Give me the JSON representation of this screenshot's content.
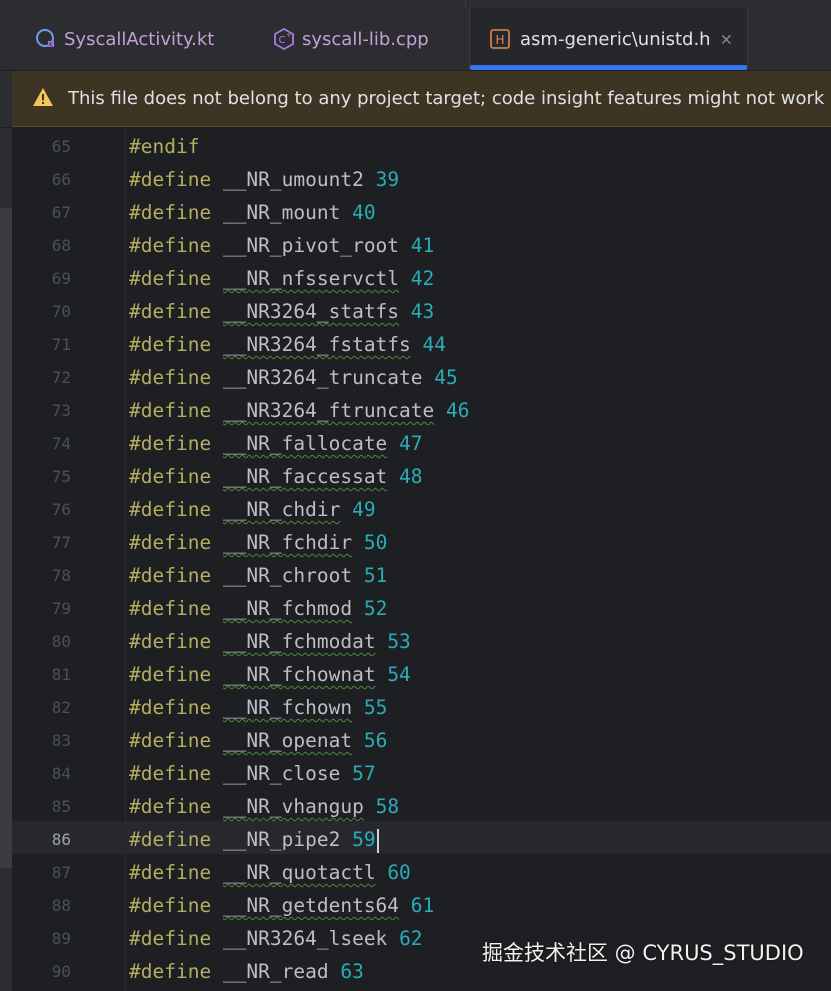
{
  "tabs": [
    {
      "label": "SyscallActivity.kt",
      "icon": "kotlin-class-icon",
      "active": false
    },
    {
      "label": "syscall-lib.cpp",
      "icon": "cpp-file-icon",
      "active": false
    },
    {
      "label": "asm-generic\\unistd.h",
      "icon": "header-file-icon",
      "active": true,
      "close": "×"
    }
  ],
  "banner": {
    "icon": "warning-icon",
    "text": "This file does not belong to any project target; code insight features might not work properly."
  },
  "editor": {
    "current_line": 86,
    "lines": [
      {
        "num": "65",
        "directive": "#endif",
        "macro": "",
        "value": "",
        "squiggle": false
      },
      {
        "num": "66",
        "directive": "#define",
        "macro": "__NR_umount2",
        "value": "39",
        "squiggle": false
      },
      {
        "num": "67",
        "directive": "#define",
        "macro": "__NR_mount",
        "value": "40",
        "squiggle": false
      },
      {
        "num": "68",
        "directive": "#define",
        "macro": "__NR_pivot_root",
        "value": "41",
        "squiggle": false
      },
      {
        "num": "69",
        "directive": "#define",
        "macro": "__NR_nfsservctl",
        "value": "42",
        "squiggle": true
      },
      {
        "num": "70",
        "directive": "#define",
        "macro": "__NR3264_statfs",
        "value": "43",
        "squiggle": true
      },
      {
        "num": "71",
        "directive": "#define",
        "macro": "__NR3264_fstatfs",
        "value": "44",
        "squiggle": true
      },
      {
        "num": "72",
        "directive": "#define",
        "macro": "__NR3264_truncate",
        "value": "45",
        "squiggle": false
      },
      {
        "num": "73",
        "directive": "#define",
        "macro": "__NR3264_ftruncate",
        "value": "46",
        "squiggle": true
      },
      {
        "num": "74",
        "directive": "#define",
        "macro": "__NR_fallocate",
        "value": "47",
        "squiggle": true
      },
      {
        "num": "75",
        "directive": "#define",
        "macro": "__NR_faccessat",
        "value": "48",
        "squiggle": true
      },
      {
        "num": "76",
        "directive": "#define",
        "macro": "__NR_chdir",
        "value": "49",
        "squiggle": true
      },
      {
        "num": "77",
        "directive": "#define",
        "macro": "__NR_fchdir",
        "value": "50",
        "squiggle": true
      },
      {
        "num": "78",
        "directive": "#define",
        "macro": "__NR_chroot",
        "value": "51",
        "squiggle": false
      },
      {
        "num": "79",
        "directive": "#define",
        "macro": "__NR_fchmod",
        "value": "52",
        "squiggle": true
      },
      {
        "num": "80",
        "directive": "#define",
        "macro": "__NR_fchmodat",
        "value": "53",
        "squiggle": true
      },
      {
        "num": "81",
        "directive": "#define",
        "macro": "__NR_fchownat",
        "value": "54",
        "squiggle": true
      },
      {
        "num": "82",
        "directive": "#define",
        "macro": "__NR_fchown",
        "value": "55",
        "squiggle": true
      },
      {
        "num": "83",
        "directive": "#define",
        "macro": "__NR_openat",
        "value": "56",
        "squiggle": true
      },
      {
        "num": "84",
        "directive": "#define",
        "macro": "__NR_close",
        "value": "57",
        "squiggle": false
      },
      {
        "num": "85",
        "directive": "#define",
        "macro": "__NR_vhangup",
        "value": "58",
        "squiggle": true
      },
      {
        "num": "86",
        "directive": "#define",
        "macro": "__NR_pipe2",
        "value": "59",
        "squiggle": false
      },
      {
        "num": "87",
        "directive": "#define",
        "macro": "__NR_quotactl",
        "value": "60",
        "squiggle": true
      },
      {
        "num": "88",
        "directive": "#define",
        "macro": "__NR_getdents64",
        "value": "61",
        "squiggle": true
      },
      {
        "num": "89",
        "directive": "#define",
        "macro": "__NR3264_lseek",
        "value": "62",
        "squiggle": false
      },
      {
        "num": "90",
        "directive": "#define",
        "macro": "__NR_read",
        "value": "63",
        "squiggle": false
      }
    ]
  },
  "watermark": "掘金技术社区 @ CYRUS_STUDIO",
  "colors": {
    "directive": "#b3ae60",
    "number": "#2aacb8",
    "macro": "#bcbec4",
    "accent": "#3574f0",
    "warning": "#f2c55c"
  }
}
